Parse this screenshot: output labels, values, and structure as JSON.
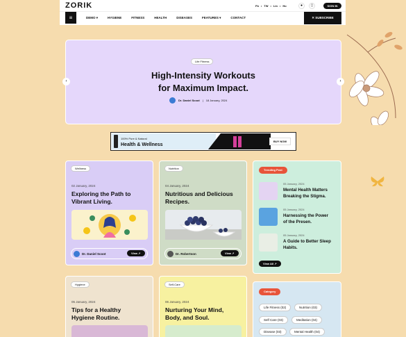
{
  "header": {
    "logo": "ZORIK",
    "social": [
      "Fb",
      "TW",
      "Lin",
      "Ho"
    ],
    "signin": "SIGN IN",
    "menu": [
      "DEMO ▾",
      "HYGIENE",
      "FITNESS",
      "HEALTH",
      "DISEASES",
      "FEATURES ▾",
      "CONTACT"
    ],
    "subscribe": "SUBSCRIBE"
  },
  "hero": {
    "tag": "Life Fitness",
    "title_line1": "High-Intensity Workouts",
    "title_line2": "for Maximum Impact.",
    "author": "Dr. Daniel Scoot",
    "date": "18 January, 2024"
  },
  "ad": {
    "small": "100% Pure & Natural",
    "big": "Health & Wellness",
    "button": "BUY NOW"
  },
  "cards": [
    {
      "tag": "Wellness",
      "date": "02 January, 2024",
      "title_line1": "Exploring the Path to",
      "title_line2": "Vibrant Living.",
      "author": "Dr. Daniel Scoot",
      "view": "View ↗"
    },
    {
      "tag": "Nutrition",
      "date": "04 January, 2024",
      "title_line1": "Nutritious and Delicious",
      "title_line2": "Recipes.",
      "author": "Dr. Robertson",
      "view": "View ↗"
    },
    {
      "tag": "Hygiene",
      "date": "05 January, 2024",
      "title_line1": "Tips for a Healthy",
      "title_line2": "Hygiene Routine."
    },
    {
      "tag": "Self-Care",
      "date": "06 January, 2024",
      "title_line1": "Nurturing Your Mind,",
      "title_line2": "Body, and Soul."
    }
  ],
  "trending": {
    "label": "Trending Post",
    "items": [
      {
        "date": "05 January, 2024",
        "title_line1": "Mental Health Matters",
        "title_line2": "Breaking the Stigma."
      },
      {
        "date": "05 January, 2024",
        "title_line1": "Harnessing the Power",
        "title_line2": "of the Presen."
      },
      {
        "date": "05 January, 2024",
        "title_line1": "A Guide to Better Sleep",
        "title_line2": "Habits."
      }
    ],
    "view_all": "View All ↗"
  },
  "category": {
    "label": "Category",
    "items": [
      "Life Fitness (02)",
      "Nutrition (03)",
      "Self Care (03)",
      "Meditation (04)",
      "Disease (03)",
      "Mental Health (04)"
    ]
  },
  "colors": {
    "background": "#f6dcae",
    "hero": "#e5d7fb",
    "accent": "#e8543a",
    "card_purple": "#d9cdf6",
    "card_green": "#cfdcc6",
    "card_mint": "#cdeedd",
    "card_beige": "#efe3cf",
    "card_yellow": "#f7f1a0",
    "card_blue": "#d6e7f2"
  },
  "icons": [
    "menu-icon",
    "search-icon",
    "bag-icon",
    "arrow-left-icon",
    "arrow-right-icon",
    "flower-decoration-icon",
    "butterfly-icon"
  ]
}
